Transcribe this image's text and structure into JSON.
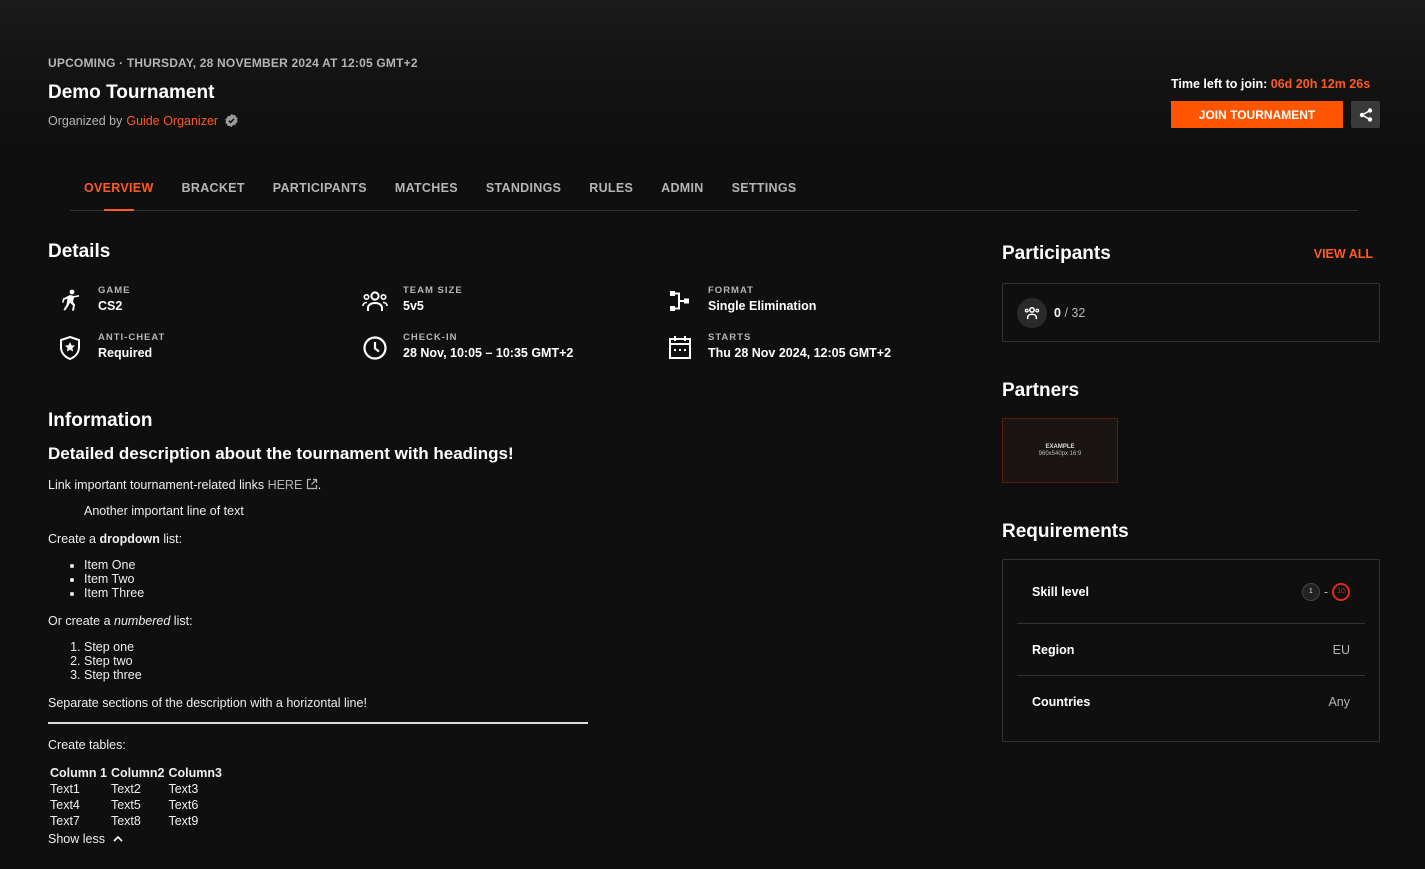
{
  "header": {
    "status_line": "UPCOMING · THURSDAY, 28 NOVEMBER 2024 AT 12:05 GMT+2",
    "title": "Demo Tournament",
    "organized_prefix": "Organized by",
    "organizer": "Guide Organizer"
  },
  "join": {
    "time_left_label": "Time left to join:",
    "time_left_value": "06d 20h 12m 26s",
    "join_label": "JOIN TOURNAMENT"
  },
  "tabs": [
    "OVERVIEW",
    "BRACKET",
    "PARTICIPANTS",
    "MATCHES",
    "STANDINGS",
    "RULES",
    "ADMIN",
    "SETTINGS"
  ],
  "details": {
    "title": "Details",
    "items": [
      {
        "label": "GAME",
        "value": "CS2",
        "icon": "player-icon"
      },
      {
        "label": "TEAM SIZE",
        "value": "5v5",
        "icon": "team-icon"
      },
      {
        "label": "FORMAT",
        "value": "Single Elimination",
        "icon": "bracket-icon"
      },
      {
        "label": "ANTI-CHEAT",
        "value": "Required",
        "icon": "shield-icon"
      },
      {
        "label": "CHECK-IN",
        "value": "28 Nov, 10:05 – 10:35 GMT+2",
        "icon": "clock-icon"
      },
      {
        "label": "STARTS",
        "value": "Thu 28 Nov 2024, 12:05 GMT+2",
        "icon": "calendar-icon"
      }
    ]
  },
  "information": {
    "title": "Information",
    "heading": "Detailed description about the tournament with headings!",
    "link_line_prefix": "Link important tournament-related links",
    "link_text": "HERE",
    "link_line_suffix": ".",
    "indented_line": "Another important line of text",
    "dropdown_prefix": "Create a",
    "dropdown_bold": "dropdown",
    "dropdown_suffix": "list:",
    "bullets": [
      "Item One",
      "Item Two",
      "Item Three"
    ],
    "numbered_prefix": "Or create a",
    "numbered_italic": "numbered",
    "numbered_suffix": "list:",
    "steps": [
      "Step one",
      "Step two",
      "Step three"
    ],
    "separator_line": "Separate sections of the description with a horizontal line!",
    "tables_line": "Create tables:",
    "table": {
      "headers": [
        "Column 1",
        "Column2",
        "Column3"
      ],
      "rows": [
        [
          "Text1",
          "Text2",
          "Text3"
        ],
        [
          "Text4",
          "Text5",
          "Text6"
        ],
        [
          "Text7",
          "Text8",
          "Text9"
        ]
      ]
    },
    "show_less": "Show less"
  },
  "participants": {
    "title": "Participants",
    "view_all": "VIEW ALL",
    "count": "0",
    "max": "/ 32"
  },
  "partners": {
    "title": "Partners",
    "card_line1": "EXAMPLE",
    "card_line2": "960x540px 16:9"
  },
  "requirements": {
    "title": "Requirements",
    "skill_label": "Skill level",
    "skill_min": "1",
    "skill_sep": "-",
    "skill_max": "10",
    "region_label": "Region",
    "region_value": "EU",
    "countries_label": "Countries",
    "countries_value": "Any"
  },
  "colors": {
    "accent": "#ff5500",
    "background": "#0f0f0f",
    "muted_text": "#b5b5b5",
    "border": "#333333"
  }
}
